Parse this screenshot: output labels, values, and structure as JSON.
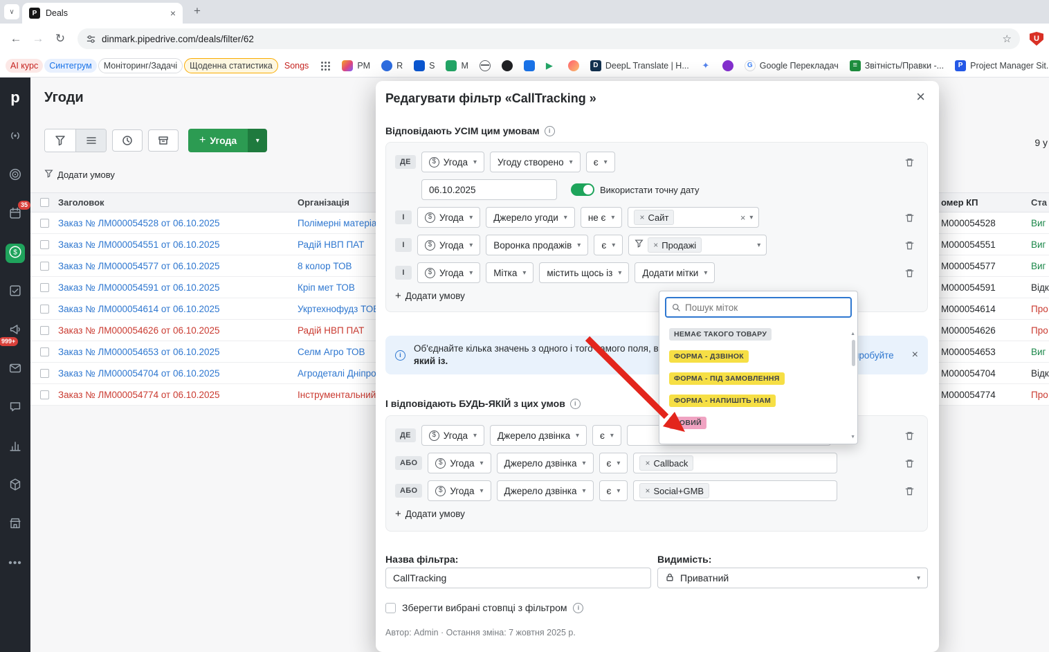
{
  "browser": {
    "tab": {
      "title": "Deals",
      "favicon": "P"
    },
    "url": "dinmark.pipedrive.com/deals/filter/62",
    "bookmarks": [
      {
        "label": "AI курс",
        "type": "chip-red",
        "icon": "none"
      },
      {
        "label": "Синтегрум",
        "type": "chip-blue",
        "icon": "none"
      },
      {
        "label": "Моніторинг/Задачі",
        "type": "chip-outline",
        "icon": "none"
      },
      {
        "label": "Щоденна статистика",
        "type": "chip-yellow",
        "icon": "none"
      },
      {
        "label": "Songs",
        "type": "text-red",
        "icon": "none"
      },
      {
        "label": "",
        "type": "plain",
        "icon": "apps"
      },
      {
        "label": "PM",
        "type": "plain",
        "icon": "pm"
      },
      {
        "label": "R",
        "type": "plain",
        "icon": "r"
      },
      {
        "label": "S",
        "type": "plain",
        "icon": "s"
      },
      {
        "label": "M",
        "type": "plain",
        "icon": "m"
      },
      {
        "label": "",
        "type": "plain",
        "icon": "globe"
      },
      {
        "label": "",
        "type": "plain",
        "icon": "dark"
      },
      {
        "label": "",
        "type": "plain",
        "icon": "chat"
      },
      {
        "label": "",
        "type": "plain",
        "icon": "play"
      },
      {
        "label": "",
        "type": "plain",
        "icon": "feather"
      },
      {
        "label": "DeepL Translate | H...",
        "type": "plain",
        "icon": "deepl"
      },
      {
        "label": "",
        "type": "plain",
        "icon": "sparkle"
      },
      {
        "label": "",
        "type": "plain",
        "icon": "purple"
      },
      {
        "label": "Google Перекладач",
        "type": "plain",
        "icon": "google"
      },
      {
        "label": "Звітність/Правки -...",
        "type": "plain",
        "icon": "sheet"
      },
      {
        "label": "Project Manager Sit...",
        "type": "plain",
        "icon": "pmblue"
      }
    ]
  },
  "sidebar": {
    "logo": "p",
    "calendar_badge": "35",
    "campaign_badge": "999+"
  },
  "page": {
    "title": "Угоди",
    "count_partial": "9 у",
    "add_deal": "Угода",
    "add_condition": "Додати умову",
    "table": {
      "headers": {
        "title": "Заголовок",
        "org": "Організація",
        "kp": "омер КП",
        "status": "Ста"
      },
      "rows": [
        {
          "title": "Заказ № ЛМ000054528 от 06.10.2025",
          "org": "Полімерні матеріа",
          "kp": "М000054528",
          "status": "Виг",
          "row_tone": "normal",
          "status_tone": "won"
        },
        {
          "title": "Заказ № ЛМ000054551 от 06.10.2025",
          "org": "Радій НВП ПАТ",
          "kp": "М000054551",
          "status": "Виг",
          "row_tone": "normal",
          "status_tone": "won"
        },
        {
          "title": "Заказ № ЛМ000054577 от 06.10.2025",
          "org": "8 колор ТОВ",
          "kp": "М000054577",
          "status": "Виг",
          "row_tone": "normal",
          "status_tone": "won"
        },
        {
          "title": "Заказ № ЛМ000054591 от 06.10.2025",
          "org": "Кріп мет ТОВ",
          "kp": "М000054591",
          "status": "Відк",
          "row_tone": "normal",
          "status_tone": "open"
        },
        {
          "title": "Заказ № ЛМ000054614 от 06.10.2025",
          "org": "Укртехнофудз ТОВ",
          "kp": "М000054614",
          "status": "Про",
          "row_tone": "normal",
          "status_tone": "lost"
        },
        {
          "title": "Заказ № ЛМ000054626 от 06.10.2025",
          "org": "Радій НВП ПАТ",
          "kp": "М000054626",
          "status": "Про",
          "row_tone": "lost",
          "status_tone": "lost"
        },
        {
          "title": "Заказ № ЛМ000054653 от 06.10.2025",
          "org": "Селм Агро ТОВ",
          "kp": "М000054653",
          "status": "Виг",
          "row_tone": "normal",
          "status_tone": "won"
        },
        {
          "title": "Заказ № ЛМ000054704 от 06.10.2025",
          "org": "Агродеталі Дніпро",
          "kp": "М000054704",
          "status": "Відк",
          "row_tone": "normal",
          "status_tone": "open"
        },
        {
          "title": "Заказ № ЛМ000054774 от 06.10.2025",
          "org": "Інструментальний",
          "kp": "М000054774",
          "status": "Про",
          "row_tone": "lost",
          "status_tone": "lost"
        }
      ]
    }
  },
  "modal": {
    "title": "Редагувати фільтр «CallTracking »",
    "all_section": "Відповідають УСІМ цим умовам",
    "any_section": "І відповідають БУДЬ-ЯКІЙ з цих умов",
    "add_condition": "Додати умову",
    "rows": {
      "r1": {
        "prefix": "ДЕ",
        "entity": "Угода",
        "field": "Угоду створено",
        "op": "є"
      },
      "r1b": {
        "date": "06.10.2025",
        "toggle_label": "Використати точну дату"
      },
      "r2": {
        "prefix": "І",
        "entity": "Угода",
        "field": "Джерело угоди",
        "op": "не є",
        "value": "Сайт"
      },
      "r3": {
        "prefix": "І",
        "entity": "Угода",
        "field": "Воронка продажів",
        "op": "є",
        "value": "Продажі"
      },
      "r4": {
        "prefix": "І",
        "entity": "Угода",
        "field": "Мітка",
        "op": "містить щось із",
        "value_placeholder": "Додати мітки"
      },
      "a1": {
        "prefix": "ДЕ",
        "entity": "Угода",
        "field": "Джерело дзвінка",
        "op": "є"
      },
      "a2": {
        "prefix": "АБО",
        "entity": "Угода",
        "field": "Джерело дзвінка",
        "op": "є",
        "value": "Callback"
      },
      "a3": {
        "prefix": "АБО",
        "entity": "Угода",
        "field": "Джерело дзвінка",
        "op": "є",
        "value": "Social+GMB"
      }
    },
    "banner": {
      "text": "Об'єднайте кілька значень з одного і того самого поля, використовуючи умову",
      "bold": "який із.",
      "link": "Спробуйте"
    },
    "labels_dropdown": {
      "search_placeholder": "Пошук міток",
      "options": [
        {
          "label": "НЕМАЄ ТАКОГО ТОВАРУ",
          "color": "gray"
        },
        {
          "label": "ФОРМА - ДЗВІНОК",
          "color": "yellow"
        },
        {
          "label": "ФОРМА - ПІД ЗАМОВЛЕННЯ",
          "color": "yellow"
        },
        {
          "label": "ФОРМА - НАПИШІТЬ НАМ",
          "color": "yellow"
        },
        {
          "label": "НОВИЙ",
          "color": "pink"
        }
      ]
    },
    "filter_name": {
      "label": "Назва фільтра:",
      "value": "CallTracking"
    },
    "visibility": {
      "label": "Видимість:",
      "value": "Приватний"
    },
    "save_columns_label": "Зберегти вибрані стовпці з фільтром",
    "footer": "Автор: Admin · Остання зміна: 7 жовтня 2025 р."
  },
  "colors": {
    "accent_green": "#2C9B52",
    "link_blue": "#2E77D0",
    "lost_red": "#CA3A30",
    "label_yellow": "#F6DF45",
    "label_pink": "#F0A3C2",
    "annotation_red": "#E3251C"
  }
}
